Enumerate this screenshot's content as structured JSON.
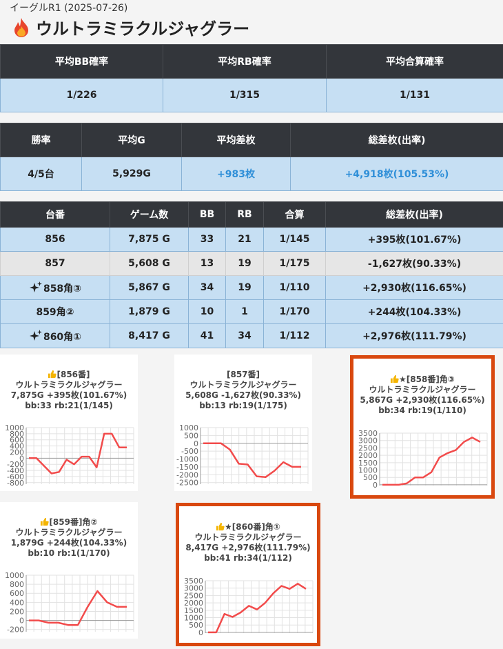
{
  "header": {
    "subtitle": "イーグルR1 (2025-07-26)",
    "title": "ウルトラミラクルジャグラー",
    "icon": "fire-icon"
  },
  "summary1": {
    "headers": [
      "平均BB確率",
      "平均RB確率",
      "平均合算確率"
    ],
    "values": [
      "1/226",
      "1/315",
      "1/131"
    ]
  },
  "summary2": {
    "headers": [
      "勝率",
      "平均G",
      "平均差枚",
      "総差枚(出率)"
    ],
    "values": [
      "4/5台",
      "5,929G",
      "+983枚",
      "+4,918枚(105.53%)"
    ]
  },
  "machines": {
    "headers": [
      "台番",
      "ゲーム数",
      "BB",
      "RB",
      "合算",
      "総差枚(出率)"
    ],
    "rows": [
      {
        "id": "856",
        "games": "7,875 G",
        "bb": "33",
        "rb": "21",
        "total": "1/145",
        "diff": "+395枚(101.67%)",
        "sparkle": false
      },
      {
        "id": "857",
        "games": "5,608 G",
        "bb": "13",
        "rb": "19",
        "total": "1/175",
        "diff": "-1,627枚(90.33%)",
        "sparkle": false
      },
      {
        "id": "858角③",
        "games": "5,867 G",
        "bb": "34",
        "rb": "19",
        "total": "1/110",
        "diff": "+2,930枚(116.65%)",
        "sparkle": true
      },
      {
        "id": "859角②",
        "games": "1,879 G",
        "bb": "10",
        "rb": "1",
        "total": "1/170",
        "diff": "+244枚(104.33%)",
        "sparkle": false
      },
      {
        "id": "860角①",
        "games": "8,417 G",
        "bb": "41",
        "rb": "34",
        "total": "1/112",
        "diff": "+2,976枚(111.79%)",
        "sparkle": true
      }
    ]
  },
  "colors": {
    "line": "#f24b4b",
    "highlight": "#d9480f",
    "header_bg": "#33363b",
    "row_bg": "#c6dff3",
    "blue_text": "#2f8fd8"
  },
  "charts": [
    {
      "line1": "[856番]",
      "line2": "ウルトラミラクルジャグラー",
      "line3": "7,875G +395枚(101.67%)",
      "line4": "bb:33 rb:21(1/145)",
      "highlight": false,
      "chart_data": {
        "type": "line",
        "yticks": [
          1000,
          800,
          600,
          400,
          200,
          0,
          -200,
          -400,
          -600,
          -800
        ],
        "ylim": [
          -850,
          1000
        ],
        "values": [
          0,
          0,
          -250,
          -500,
          -450,
          -50,
          -200,
          50,
          50,
          -300,
          800,
          800,
          350,
          350
        ]
      }
    },
    {
      "line1": "[857番]",
      "line2": "ウルトラミラクルジャグラー",
      "line3": "5,608G -1,627枚(90.33%)",
      "line4": "bb:13 rb:19(1/175)",
      "highlight": false,
      "chart_data": {
        "type": "line",
        "yticks": [
          1000,
          500,
          0,
          -500,
          -1000,
          -1500,
          -2000,
          -2500
        ],
        "ylim": [
          -2600,
          1000
        ],
        "values": [
          0,
          0,
          0,
          -400,
          -1300,
          -1350,
          -2100,
          -2150,
          -1750,
          -1200,
          -1500,
          -1500
        ]
      }
    },
    {
      "line1": "★[858番]角③",
      "line2": "ウルトラミラクルジャグラー",
      "line3": "5,867G +2,930枚(116.65%)",
      "line4": "bb:34 rb:19(1/110)",
      "highlight": true,
      "chart_data": {
        "type": "line",
        "yticks": [
          3500,
          3000,
          2500,
          2000,
          1500,
          1000,
          500,
          0
        ],
        "ylim": [
          -50,
          3500
        ],
        "values": [
          0,
          0,
          0,
          100,
          500,
          500,
          850,
          1850,
          2150,
          2350,
          2900,
          3200,
          2900
        ]
      }
    },
    {
      "line1": "[859番]角②",
      "line2": "ウルトラミラクルジャグラー",
      "line3": "1,879G +244枚(104.33%)",
      "line4": "bb:10 rb:1(1/170)",
      "highlight": false,
      "chart_data": {
        "type": "line",
        "yticks": [
          1000,
          800,
          600,
          400,
          200,
          0,
          -200
        ],
        "ylim": [
          -250,
          1000
        ],
        "values": [
          0,
          0,
          -50,
          -50,
          -100,
          -100,
          300,
          650,
          400,
          300,
          300
        ]
      }
    },
    {
      "line1": "★[860番]角①",
      "line2": "ウルトラミラクルジャグラー",
      "line3": "8,417G +2,976枚(111.79%)",
      "line4": "bb:41 rb:34(1/112)",
      "highlight": true,
      "chart_data": {
        "type": "line",
        "yticks": [
          3500,
          3000,
          2500,
          2000,
          1500,
          1000,
          500,
          0
        ],
        "ylim": [
          -50,
          3500
        ],
        "values": [
          0,
          0,
          1250,
          1050,
          1350,
          1800,
          1550,
          2000,
          2650,
          3150,
          2950,
          3300,
          2950
        ]
      }
    }
  ]
}
